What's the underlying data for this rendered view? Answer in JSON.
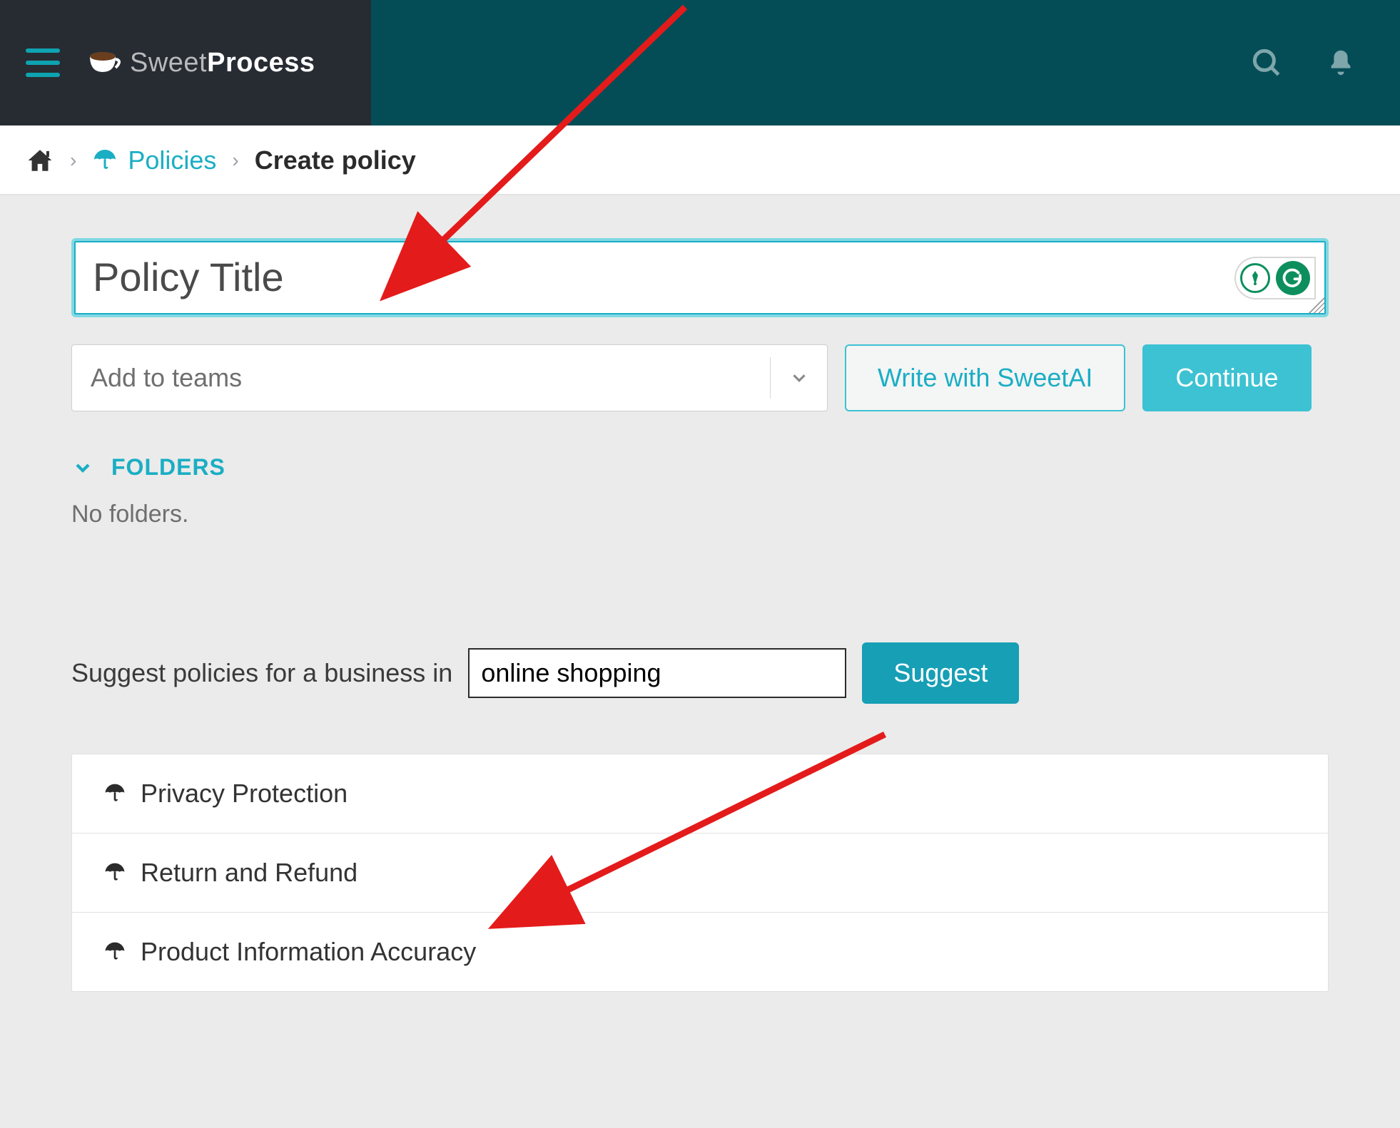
{
  "brand": {
    "sweet": "Sweet",
    "process": "Process"
  },
  "breadcrumb": {
    "policies_label": "Policies",
    "current": "Create policy"
  },
  "title": {
    "placeholder": "Policy Title",
    "value": ""
  },
  "teams": {
    "placeholder": "Add to teams"
  },
  "actions": {
    "ai_label": "Write with SweetAI",
    "continue_label": "Continue"
  },
  "folders": {
    "header": "FOLDERS",
    "empty": "No folders."
  },
  "suggest": {
    "prompt_prefix": "Suggest policies for a business in",
    "input_value": "online shopping",
    "button": "Suggest"
  },
  "suggestions": [
    {
      "label": "Privacy Protection"
    },
    {
      "label": "Return and Refund"
    },
    {
      "label": "Product Information Accuracy"
    }
  ],
  "colors": {
    "accent": "#1aaec4",
    "header_dark": "#272c33",
    "header_teal": "#044d56",
    "arrow": "#e41b1b"
  }
}
